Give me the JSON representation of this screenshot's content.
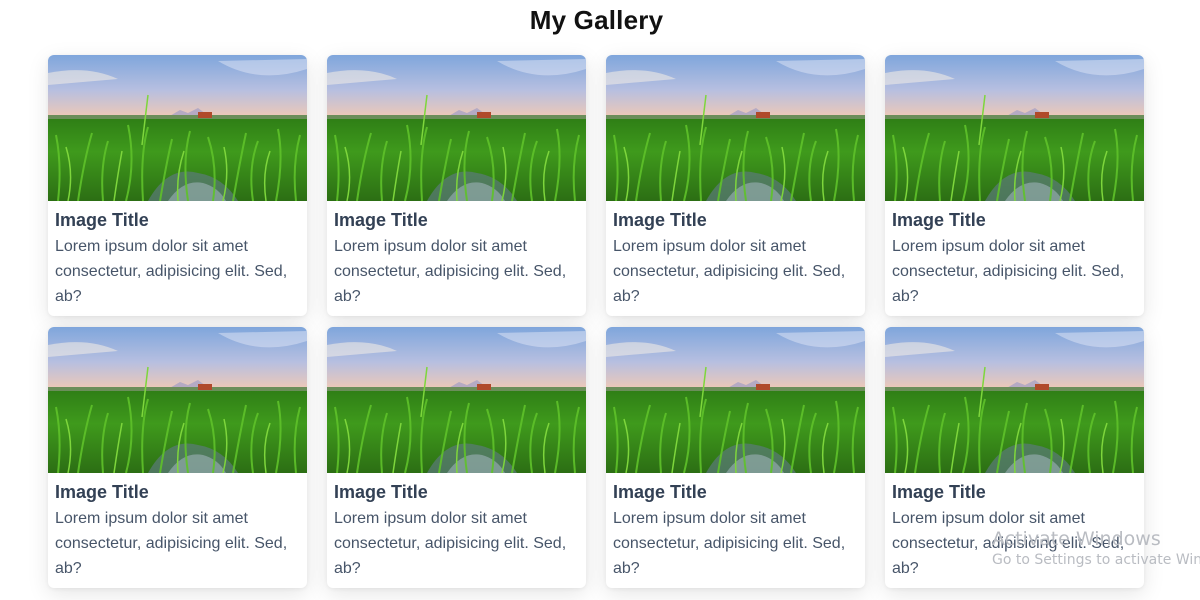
{
  "page": {
    "title": "My Gallery"
  },
  "gallery": {
    "cards": [
      {
        "title": "Image Title",
        "text": "Lorem ipsum dolor sit amet consectetur, adipisicing elit. Sed, ab?"
      },
      {
        "title": "Image Title",
        "text": "Lorem ipsum dolor sit amet consectetur, adipisicing elit. Sed, ab?"
      },
      {
        "title": "Image Title",
        "text": "Lorem ipsum dolor sit amet consectetur, adipisicing elit. Sed, ab?"
      },
      {
        "title": "Image Title",
        "text": "Lorem ipsum dolor sit amet consectetur, adipisicing elit. Sed, ab?"
      },
      {
        "title": "Image Title",
        "text": "Lorem ipsum dolor sit amet consectetur, adipisicing elit. Sed, ab?"
      },
      {
        "title": "Image Title",
        "text": "Lorem ipsum dolor sit amet consectetur, adipisicing elit. Sed, ab?"
      },
      {
        "title": "Image Title",
        "text": "Lorem ipsum dolor sit amet consectetur, adipisicing elit. Sed, ab?"
      },
      {
        "title": "Image Title",
        "text": "Lorem ipsum dolor sit amet consectetur, adipisicing elit. Sed, ab?"
      }
    ]
  },
  "watermark": {
    "title": "Activate Windows",
    "subtitle": "Go to Settings to activate Windows."
  },
  "colors": {
    "title": "#111111",
    "card_title": "#334155",
    "card_text": "#475569",
    "sky_top": "#7fa6dc",
    "sky_horizon": "#f2c9b4",
    "grass": "#3f9a1c"
  }
}
